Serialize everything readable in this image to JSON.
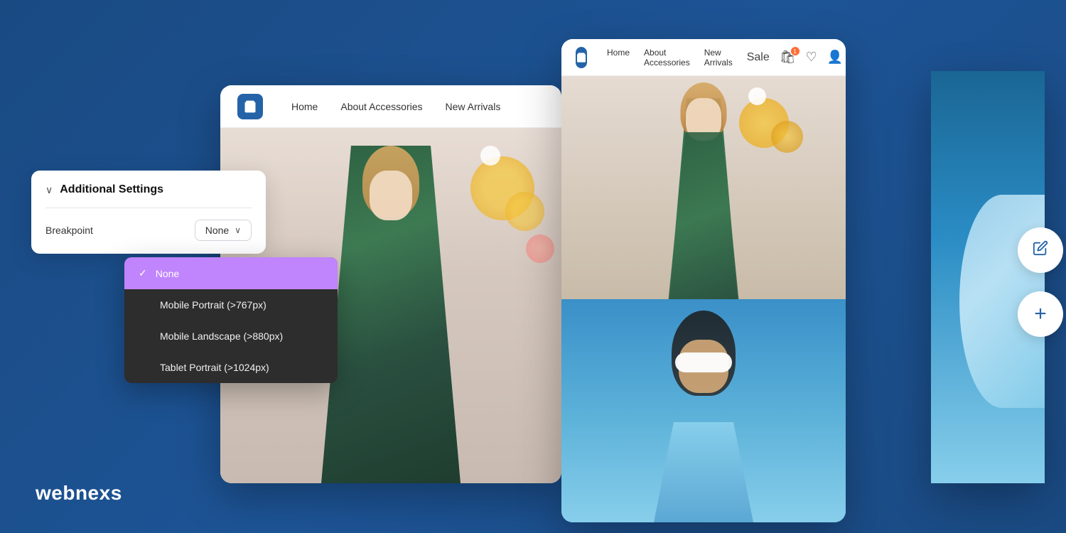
{
  "brand": {
    "name": "webnexs",
    "logo_char": "🛍"
  },
  "main_card": {
    "nav": {
      "home": "Home",
      "about": "About Accessories",
      "new_arrivals": "New Arrivals"
    }
  },
  "right_card": {
    "nav": {
      "home": "Home",
      "about": "About Accessories",
      "new_arrivals": "New Arrivals",
      "sale": "Sale"
    },
    "cart_count": "1"
  },
  "settings_panel": {
    "title": "Additional Settings",
    "breakpoint_label": "Breakpoint",
    "selected_value": "None",
    "chevron": "⌄"
  },
  "dropdown": {
    "items": [
      {
        "label": "None",
        "selected": true
      },
      {
        "label": "Mobile Portrait (>767px)",
        "selected": false
      },
      {
        "label": "Mobile Landscape (>880px)",
        "selected": false
      },
      {
        "label": "Tablet Portrait (>1024px)",
        "selected": false
      }
    ]
  },
  "icons": {
    "cart": "🛒",
    "heart": "♡",
    "user": "👤",
    "check": "✓",
    "chevron_down": "∨",
    "edit": "✏",
    "add": "+",
    "logo_bag": "👜"
  }
}
